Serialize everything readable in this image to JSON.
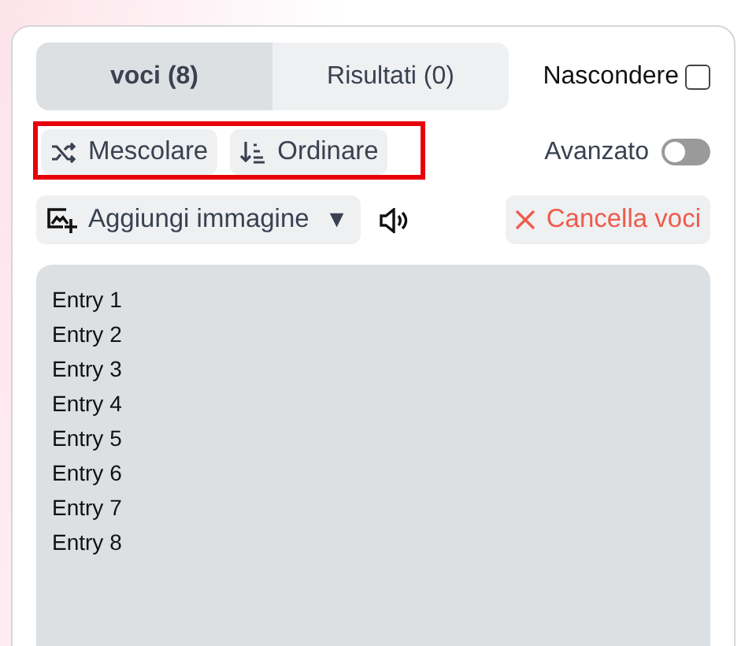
{
  "tabs": [
    {
      "label": "voci (8)",
      "selected": true
    },
    {
      "label": "Risultati (0)",
      "selected": false
    }
  ],
  "hide": {
    "label": "Nascondere",
    "checked": false
  },
  "actions": [
    {
      "label": "Mescolare",
      "kind": "shuffle"
    },
    {
      "label": "Ordinare",
      "kind": "sort"
    }
  ],
  "advanced": {
    "label": "Avanzato",
    "on": false
  },
  "add_image": {
    "label": "Aggiungi immagine",
    "caret": "▼"
  },
  "clear": {
    "label": "Cancella voci"
  },
  "entries": [
    "Entry 1",
    "Entry 2",
    "Entry 3",
    "Entry 4",
    "Entry 5",
    "Entry 6",
    "Entry 7",
    "Entry 8"
  ]
}
